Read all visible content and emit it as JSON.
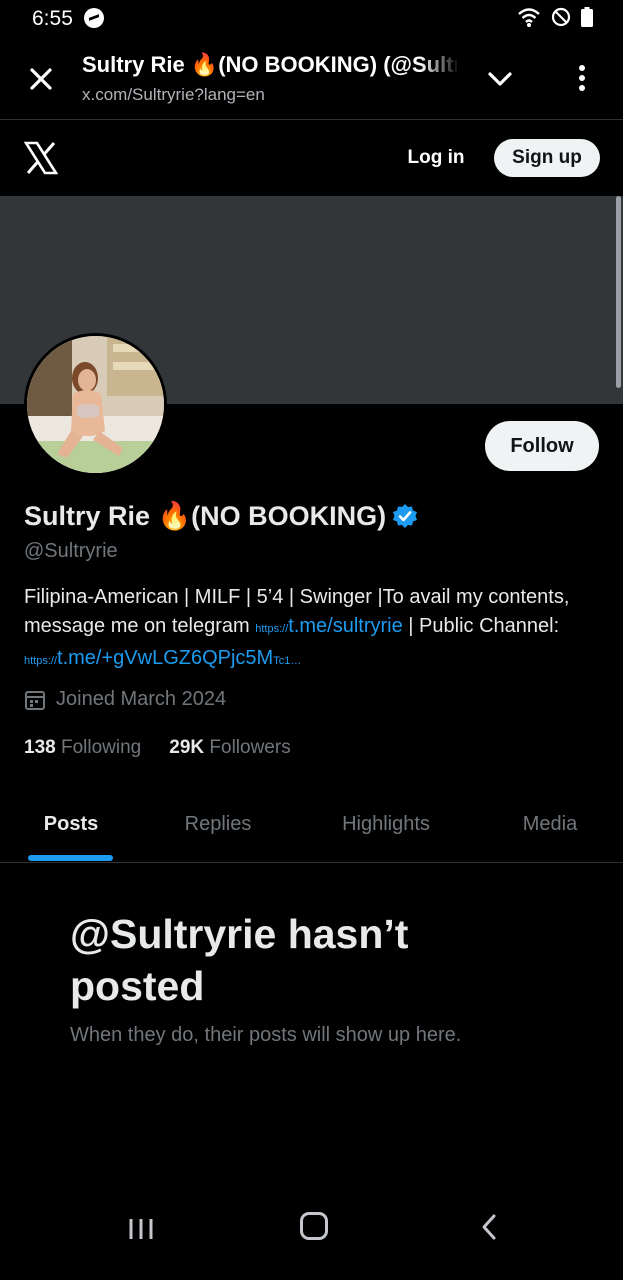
{
  "status_bar": {
    "time": "6:55"
  },
  "browser": {
    "title": "Sultry Rie 🔥(NO BOOKING) (@Sultryrie) / X",
    "url": "x.com/Sultryrie?lang=en"
  },
  "header": {
    "login_label": "Log in",
    "signup_label": "Sign up"
  },
  "profile": {
    "name": "Sultry Rie 🔥(NO BOOKING)",
    "handle": "@Sultryrie",
    "follow_label": "Follow",
    "bio": {
      "text1": "Filipina-American | MILF | 5’4 | Swinger |To avail my contents, message me on telegram ",
      "link1_prefix": "https://",
      "link1": "t.me/sultryrie",
      "text2": " | Public Channel: ",
      "link2_prefix": "https://",
      "link2": "t.me/+gVwLGZ6QPjc5M",
      "link2_tail": "Tc1…"
    },
    "joined": "Joined March 2024",
    "following_count": "138",
    "following_label": "Following",
    "followers_count": "29K",
    "followers_label": "Followers"
  },
  "tabs": [
    {
      "label": "Posts"
    },
    {
      "label": "Replies"
    },
    {
      "label": "Highlights"
    },
    {
      "label": "Media"
    }
  ],
  "empty_state": {
    "title": "@Sultryrie hasn’t posted",
    "subtitle": "When they do, their posts will show up here."
  },
  "colors": {
    "accent": "#1d9bf0",
    "background": "#000000",
    "banner": "#333639",
    "muted": "#71767b"
  }
}
